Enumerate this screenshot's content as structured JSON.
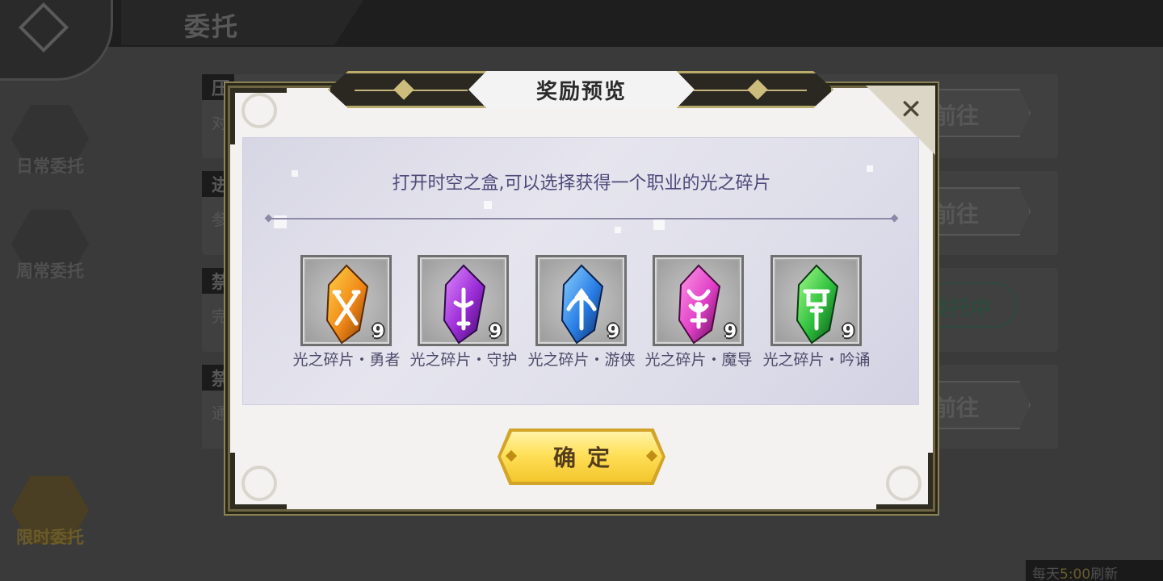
{
  "background": {
    "page_title": "委托",
    "side_tabs": [
      {
        "label": "日常委托"
      },
      {
        "label": "周常委托"
      },
      {
        "label": "限时委托"
      }
    ],
    "tasks": [
      {
        "tag": "压",
        "sub": "对"
      },
      {
        "tag": "进",
        "sub": "参"
      },
      {
        "tag": "禁",
        "sub": "完"
      },
      {
        "tag": "禁",
        "sub": "通"
      }
    ],
    "go_label": "前往",
    "in_progress_label": "委托中",
    "refresh_prefix": "每天",
    "refresh_time": "5:00",
    "refresh_suffix": "刷新"
  },
  "dialog": {
    "title": "奖励预览",
    "description": "打开时空之盒,可以选择获得一个职业的光之碎片",
    "items": [
      {
        "name": "光之碎片・勇者",
        "count": "9",
        "color": "#f08a18",
        "icon": "crossed-swords-icon"
      },
      {
        "name": "光之碎片・守护",
        "count": "9",
        "color": "#9a2bd6",
        "icon": "sword-icon"
      },
      {
        "name": "光之碎片・游侠",
        "count": "9",
        "color": "#2a7ee6",
        "icon": "bow-icon"
      },
      {
        "name": "光之碎片・魔导",
        "count": "9",
        "color": "#e03fc6",
        "icon": "magic-orb-icon"
      },
      {
        "name": "光之碎片・吟诵",
        "count": "9",
        "color": "#2fbf3e",
        "icon": "banner-icon"
      }
    ],
    "confirm_label": "确定",
    "close_glyph": "✕"
  }
}
